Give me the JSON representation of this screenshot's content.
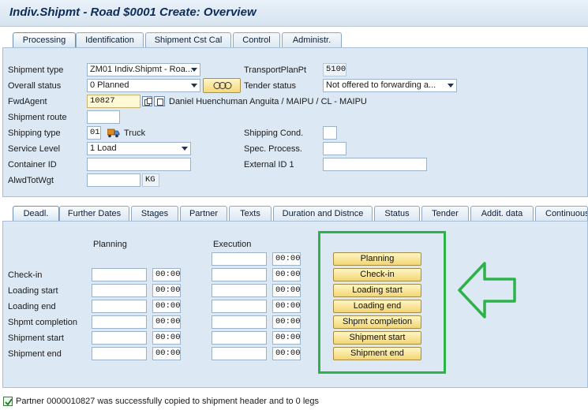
{
  "window": {
    "title": "Indiv.Shipmt - Road $0001 Create: Overview"
  },
  "top_tabs": [
    {
      "label": "Processing",
      "active": true
    },
    {
      "label": "Identification"
    },
    {
      "label": "Shipment Cst Cal"
    },
    {
      "label": "Control"
    },
    {
      "label": "Administr."
    }
  ],
  "header": {
    "shipment_type": {
      "label": "Shipment type",
      "value": "ZM01 Indiv.Shipmt - Roa..."
    },
    "transport_plan_pt": {
      "label": "TransportPlanPt",
      "value": "5100"
    },
    "overall_status": {
      "label": "Overall status",
      "value": "0 Planned"
    },
    "status_button_icon": "dots-icon",
    "tender_status": {
      "label": "Tender status",
      "value": "Not offered to forwarding a..."
    },
    "fwd_agent": {
      "label": "FwdAgent",
      "value": "10827",
      "description": "Daniel Huenchuman Anguita / MAIPU / CL -  MAIPU"
    },
    "shipment_route": {
      "label": "Shipment route",
      "value": ""
    },
    "shipping_type": {
      "label": "Shipping type",
      "value": "01",
      "text": "Truck",
      "icon": "truck-icon"
    },
    "shipping_cond": {
      "label": "Shipping Cond.",
      "value": ""
    },
    "service_level": {
      "label": "Service Level",
      "value": "1 Load"
    },
    "spec_process": {
      "label": "Spec. Process.",
      "value": ""
    },
    "container_id": {
      "label": "Container ID",
      "value": ""
    },
    "external_id_1": {
      "label": "External ID 1",
      "value": ""
    },
    "alwd_tot_wgt": {
      "label": "AlwdTotWgt",
      "value": "",
      "unit": "KG"
    }
  },
  "detail_tabs": [
    {
      "label": "Deadl.",
      "active": true
    },
    {
      "label": "Further Dates"
    },
    {
      "label": "Stages"
    },
    {
      "label": "Partner"
    },
    {
      "label": "Texts"
    },
    {
      "label": "Duration and Distnce"
    },
    {
      "label": "Status"
    },
    {
      "label": "Tender"
    },
    {
      "label": "Addit. data"
    },
    {
      "label": "Continuous"
    }
  ],
  "deadlines": {
    "planning_header": "Planning",
    "execution_header": "Execution",
    "execution_top_time": "00:00",
    "rows": [
      {
        "label": "Check-in",
        "planning_time": "00:00",
        "execution_time": "00:00"
      },
      {
        "label": "Loading start",
        "planning_time": "00:00",
        "execution_time": "00:00"
      },
      {
        "label": "Loading end",
        "planning_time": "00:00",
        "execution_time": "00:00"
      },
      {
        "label": "Shpmt completion",
        "planning_time": "00:00",
        "execution_time": "00:00"
      },
      {
        "label": "Shipment start",
        "planning_time": "00:00",
        "execution_time": "00:00"
      },
      {
        "label": "Shipment end",
        "planning_time": "00:00",
        "execution_time": "00:00"
      }
    ],
    "buttons": [
      "Planning",
      "Check-in",
      "Loading start",
      "Loading end",
      "Shpmt completion",
      "Shipment start",
      "Shipment end"
    ]
  },
  "annotation": {
    "highlight_color": "#2db24a",
    "arrow_icon": "left-arrow-icon"
  },
  "status_bar": {
    "icon": "checkmark-icon",
    "message": "Partner 0000010827 was successfully copied to shipment header and to 0 legs"
  }
}
